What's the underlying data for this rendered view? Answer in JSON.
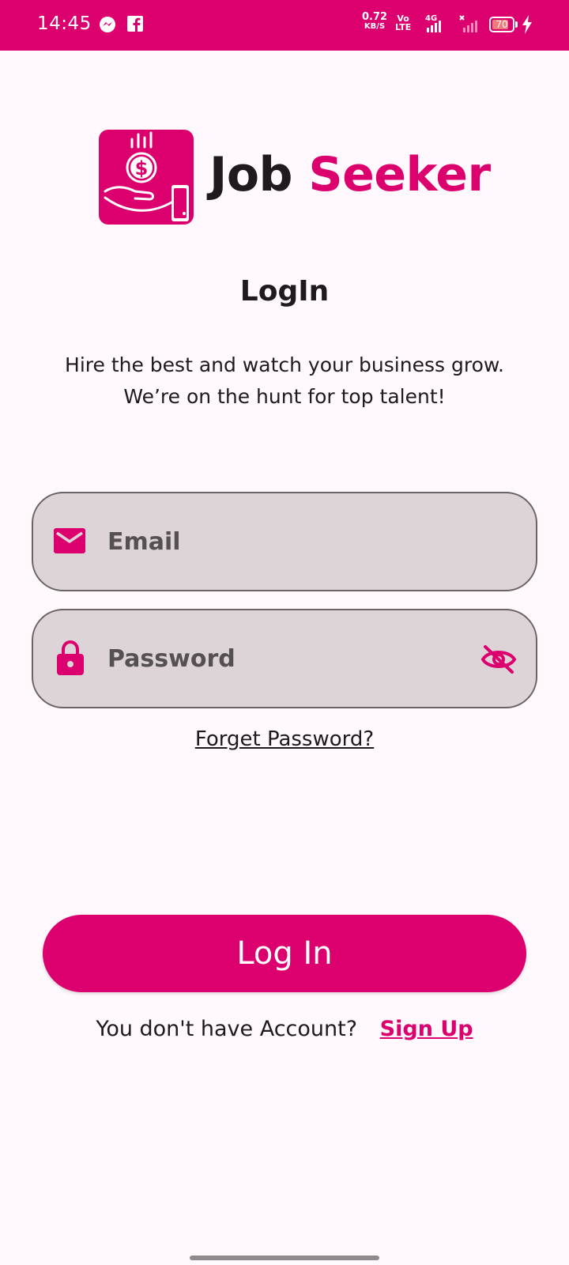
{
  "status_bar": {
    "time": "14:45",
    "net_speed_value": "0.72",
    "net_speed_unit": "KB/S",
    "volte_top": "Vo",
    "volte_bottom": "LTE",
    "network": "4G",
    "battery": "70",
    "icons": [
      "messenger-icon",
      "facebook-icon",
      "signal-icon",
      "no-signal-icon",
      "battery-icon",
      "charging-icon"
    ]
  },
  "logo": {
    "word1": "Job",
    "word2": "Seeker",
    "icon": "money-hand-icon"
  },
  "title": "LogIn",
  "subtitle_line1": "Hire the best and watch your business grow.",
  "subtitle_line2": "We’re on the hunt for top talent!",
  "form": {
    "email_placeholder": "Email",
    "email_value": "",
    "password_placeholder": "Password",
    "password_value": "",
    "forget_password": "Forget Password?"
  },
  "login_button": "Log In",
  "signup": {
    "prompt": "You don't have Account?",
    "link": "Sign Up"
  },
  "colors": {
    "primary": "#dc006f",
    "field_background": "#dcd4d6",
    "page_background": "#fff8fc"
  }
}
